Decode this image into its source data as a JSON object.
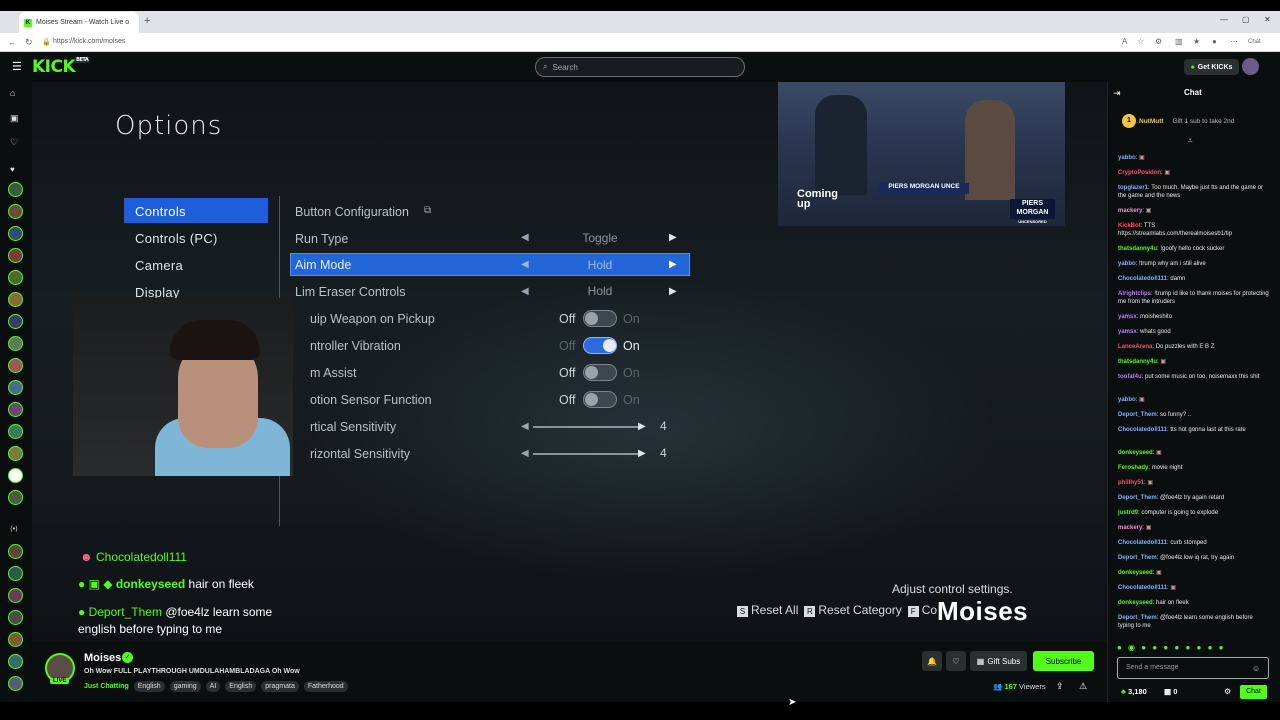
{
  "browser": {
    "tab_title": "Moises Stream - Watch Live o",
    "url": "https://kick.com/moises",
    "new_tab": "+",
    "chat_ext": "Chat"
  },
  "header": {
    "logo": "KICK",
    "beta": "BETA",
    "search_placeholder": "Search",
    "get_kicks": "Get KICKs"
  },
  "game": {
    "title": "Options",
    "categories": [
      "Controls",
      "Controls (PC)",
      "Camera",
      "Display"
    ],
    "options": [
      {
        "label": "Button Configuration",
        "value": ""
      },
      {
        "label": "Run Type",
        "value": "Toggle"
      },
      {
        "label": "Aim Mode",
        "value": "Hold"
      },
      {
        "label": "Lim Eraser Controls",
        "value": "Hold"
      },
      {
        "label": "uip Weapon on Pickup",
        "off": "Off",
        "on": "On"
      },
      {
        "label": "ntroller Vibration",
        "off": "Off",
        "on": "On"
      },
      {
        "label": "m Assist",
        "off": "Off",
        "on": "On"
      },
      {
        "label": "otion Sensor Function",
        "off": "Off",
        "on": "On"
      },
      {
        "label": "rtical Sensitivity",
        "value": "4"
      },
      {
        "label": "rizontal Sensitivity",
        "value": "4"
      }
    ],
    "hint": "Adjust control settings.",
    "footer": {
      "reset_all": "Reset All",
      "reset_cat": "Reset Category",
      "controls": "Co",
      "k_s": "S",
      "k_r": "R",
      "k_f": "F"
    },
    "watermark": "Moises"
  },
  "overlay_chat": [
    {
      "user": "Chocolatedoll111",
      "text": ""
    },
    {
      "user": "donkeyseed",
      "text": "hair on fleek"
    },
    {
      "user": "Deport_Them",
      "text": "@foe4lz learn some"
    },
    {
      "user": "",
      "text": "english before typing to me"
    }
  ],
  "pip": {
    "coming": "Coming",
    "up": "up",
    "show": "PIERS MORGAN UNCE",
    "brand1": "PIERS",
    "brand2": "MORGAN",
    "brand3": "UNCENSORED"
  },
  "stream": {
    "name": "Moises",
    "live": "LIVE",
    "title": "Oh Wow FULL PLAYTHROUGH UMDULAHAMBLADAGA Oh Wow",
    "category": "Just Chatting",
    "tags": [
      "English",
      "gaming",
      "AI",
      "English",
      "pragmata",
      "Fatherhood"
    ],
    "gift_subs": "Gift Subs",
    "subscribe": "Subscribe",
    "viewers_count": "167",
    "viewers_label": "Viewers"
  },
  "chat": {
    "title": "Chat",
    "pinned_user": "NutMutt",
    "pinned_rank": "1",
    "pinned_info": "Gift 1 sub to take 2nd",
    "messages": [
      {
        "user": "yabbo",
        "text": "",
        "color": "#7fb0ff"
      },
      {
        "user": "CryptoPosidon",
        "text": "",
        "color": "#ff4d6d"
      },
      {
        "user": "topglazer1",
        "text": "Too much. Maybe just tts and the game or the game and the news",
        "color": "#7fb0ff"
      },
      {
        "user": "mackery",
        "text": "",
        "color": "#ff8ad8"
      },
      {
        "user": "KickBot",
        "text": "TTS https://streamlabs.com/therealmoisesb1/tip",
        "color": "#ff4d6d"
      },
      {
        "user": "thatsdanny4u",
        "text": "!goofy hello cock sucker",
        "color": "#53fc18"
      },
      {
        "user": "yabbo",
        "text": "!trump why am i still alive",
        "color": "#7fb0ff"
      },
      {
        "user": "Chocolatedoll111",
        "text": "damn",
        "color": "#7fb0ff"
      },
      {
        "user": "Alrightclips",
        "text": "!trump id like to thank moises for protecting me from the intruders",
        "color": "#b57bff"
      },
      {
        "user": "yamsx",
        "text": "moisheshito",
        "color": "#b57bff"
      },
      {
        "user": "yamsx",
        "text": "whats good",
        "color": "#b57bff"
      },
      {
        "user": "LanceArena",
        "text": "Do puzzles with E B Z",
        "color": "#ff4d6d"
      },
      {
        "user": "thatsdanny4u",
        "text": "",
        "color": "#53fc18"
      },
      {
        "user": "toofat4u",
        "text": "put some music on too, noisemaxx this shit",
        "color": "#b57bff"
      },
      {
        "user": "yabbo",
        "text": "",
        "color": "#7fb0ff"
      },
      {
        "user": "Deport_Them",
        "text": "so funny? ..",
        "color": "#7fb0ff"
      },
      {
        "user": "Chocolatedoll111",
        "text": "tts not gonna last at this rate",
        "color": "#7fb0ff"
      },
      {
        "user": "donkeyseed",
        "text": "",
        "color": "#53fc18"
      },
      {
        "user": "Feroshady",
        "text": "movie night",
        "color": "#53fc18"
      },
      {
        "user": "phillhy51",
        "text": "",
        "color": "#ff4d6d"
      },
      {
        "user": "Deport_Them",
        "text": "@foe4lz try again retard",
        "color": "#7fb0ff"
      },
      {
        "user": "justrd9",
        "text": "computer is going to explode",
        "color": "#53fc18"
      },
      {
        "user": "mackery",
        "text": "",
        "color": "#ff8ad8"
      },
      {
        "user": "Chocolatedoll111",
        "text": "curb stomped",
        "color": "#7fb0ff"
      },
      {
        "user": "Deport_Them",
        "text": "@foe4lz low iq rat, try again",
        "color": "#7fb0ff"
      },
      {
        "user": "donkeyseed",
        "text": "",
        "color": "#53fc18"
      },
      {
        "user": "Chocolatedoll111",
        "text": "",
        "color": "#7fb0ff"
      },
      {
        "user": "donkeyseed",
        "text": "hair on fleek",
        "color": "#53fc18"
      },
      {
        "user": "Deport_Them",
        "text": "@foe4lz learn some english before typing to me",
        "color": "#7fb0ff"
      }
    ],
    "send_placeholder": "Send a message",
    "kicks": "3,180",
    "gifts": "0",
    "chat_button": "Chat"
  },
  "colors": {
    "brand": "#53fc18",
    "select": "#1d5fdb"
  }
}
